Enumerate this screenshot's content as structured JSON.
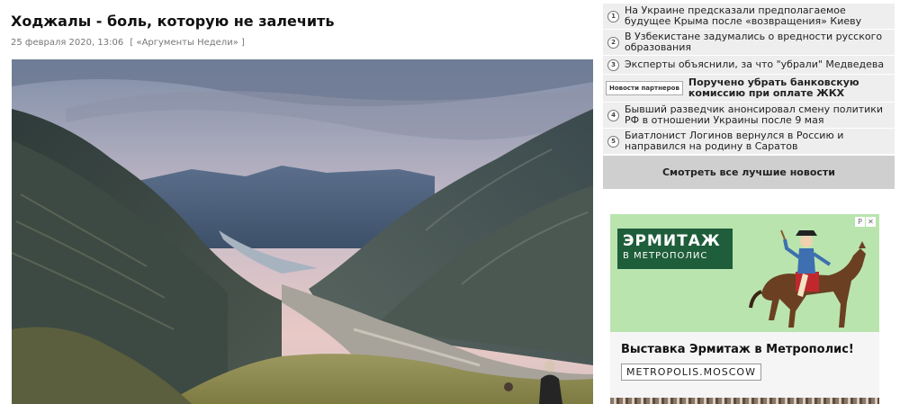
{
  "article": {
    "title": "Ходжалы - боль, которую не залечить",
    "date": "25 февраля 2020, 13:06",
    "source": "[ «Аргументы Недели» ]"
  },
  "sidebar": {
    "items": [
      {
        "num": "1",
        "text": "На Украине предсказали предполагаемое будущее Крыма после «возвращения» Киеву"
      },
      {
        "num": "2",
        "text": "В Узбекистане задумались о вредности русского образования"
      },
      {
        "num": "3",
        "text": "Эксперты объяснили, за что \"убрали\" Медведева"
      },
      {
        "badge": "Новости партнеров",
        "text": "Поручено убрать банковскую комиссию при оплате ЖКХ"
      },
      {
        "num": "4",
        "text": "Бывший разведчик анонсировал смену политики РФ в отношении Украины после 9 мая"
      },
      {
        "num": "5",
        "text": "Биатлонист Логинов вернулся в Россию и направился на родину в Саратов"
      }
    ],
    "all_news_label": "Смотреть все лучшие новости"
  },
  "ad": {
    "brand_main": "ЭРМИТАЖ",
    "brand_sub": "В МЕТРОПОЛИС",
    "headline": "Выставка Эрмитаж в Метрополис!",
    "url": "METROPOLIS.MOSCOW",
    "marker_p": "P",
    "marker_x": "✕",
    "colors": {
      "background": "#b9e4ae",
      "brand_box": "#1f5e3a"
    }
  }
}
